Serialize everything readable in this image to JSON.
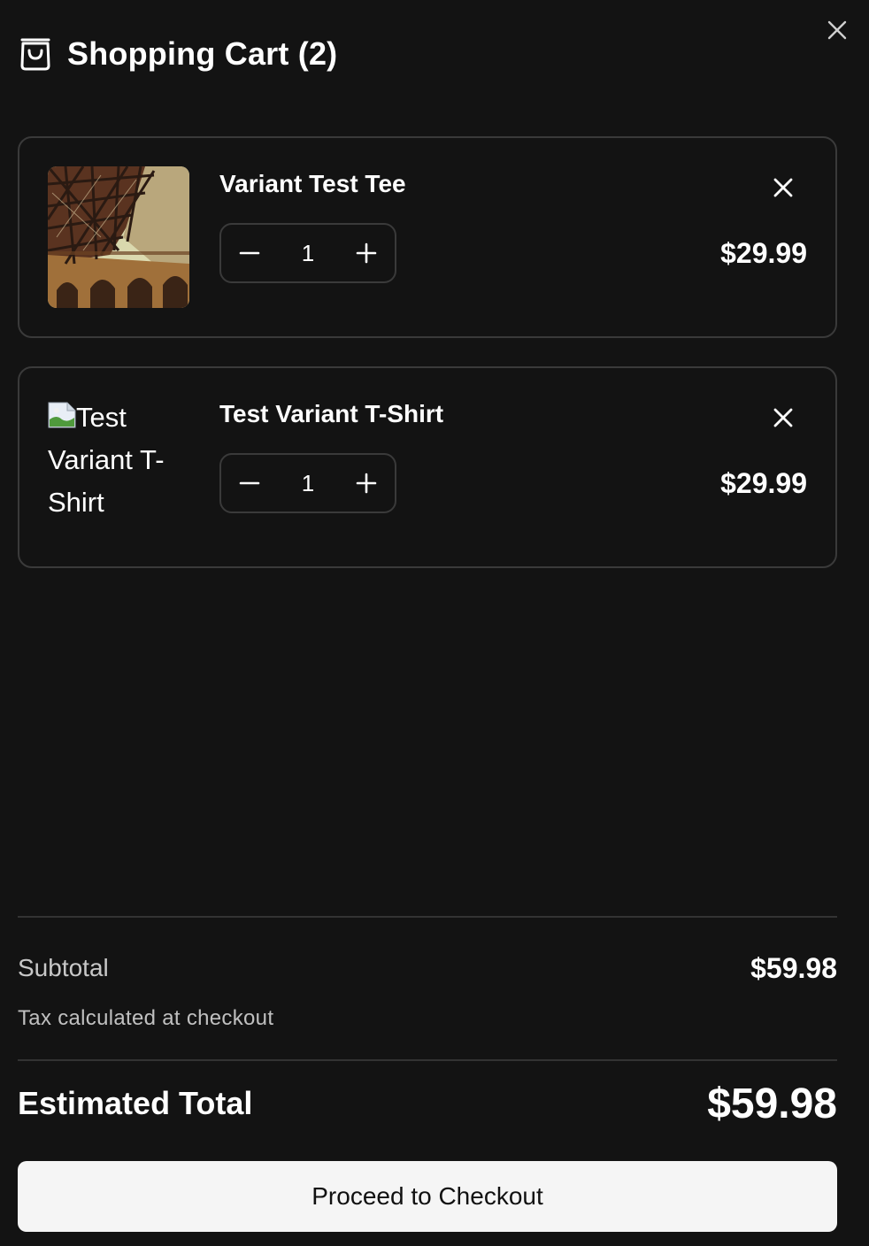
{
  "header": {
    "title": "Shopping Cart (2)"
  },
  "items": [
    {
      "name": "Variant Test Tee",
      "quantity": "1",
      "price": "$29.99",
      "image_alt": ""
    },
    {
      "name": "Test Variant T-Shirt",
      "quantity": "1",
      "price": "$29.99",
      "image_alt": "Test Variant T-Shirt"
    }
  ],
  "summary": {
    "subtotal_label": "Subtotal",
    "subtotal_value": "$59.98",
    "tax_note": "Tax calculated at checkout",
    "total_label": "Estimated Total",
    "total_value": "$59.98"
  },
  "checkout": {
    "label": "Proceed to Checkout"
  },
  "colors": {
    "background": "#131313",
    "border": "#3a3a3a",
    "button_bg": "#f5f5f5",
    "button_text": "#111111"
  },
  "icons": [
    "shopping-bag-icon",
    "close-icon",
    "minus-icon",
    "plus-icon",
    "broken-image-icon"
  ]
}
